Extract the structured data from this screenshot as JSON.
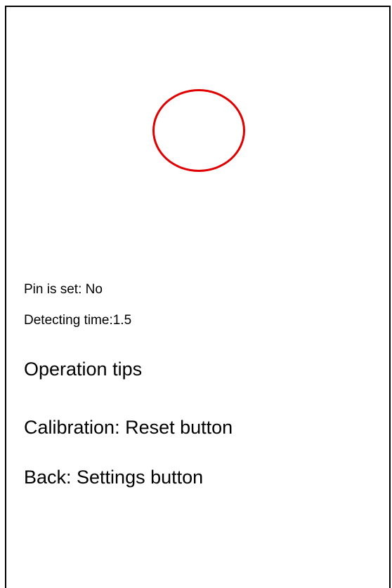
{
  "status": {
    "pin_label": "Pin is set: No",
    "detecting_time_label": "Detecting time:1.5"
  },
  "tips": {
    "heading": "Operation tips",
    "calibration": "Calibration: Reset button",
    "back": "Back: Settings button"
  },
  "colors": {
    "target_ring": "#e00000",
    "text": "#000000",
    "background": "#ffffff"
  },
  "icons": {
    "target": "target-ring-icon"
  }
}
